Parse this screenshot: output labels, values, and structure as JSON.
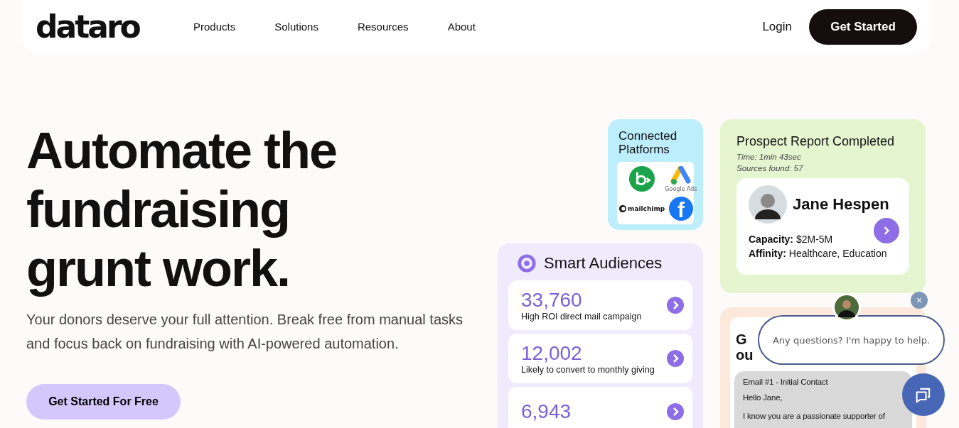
{
  "nav": {
    "logo": "dataro",
    "links": [
      "Products",
      "Solutions",
      "Resources",
      "About"
    ],
    "login": "Login",
    "cta": "Get Started"
  },
  "hero": {
    "title_lines": [
      "Automate the",
      "fundraising",
      "grunt work."
    ],
    "subtitle": "Your donors deserve your full attention. Break free from manual tasks and focus back on fundraising with AI-powered automation.",
    "cta": "Get Started For Free"
  },
  "connected": {
    "title": "Connected Platforms",
    "platforms": [
      {
        "kind": "green-circle"
      },
      {
        "kind": "ads",
        "label": "Google Ads"
      },
      {
        "kind": "wordmark",
        "label": "mailchimp"
      },
      {
        "kind": "blue-f",
        "label": "f"
      }
    ]
  },
  "prospect": {
    "title": "Prospect Report Completed",
    "time": "Time: 1min 43sec",
    "sources": "Sources found: 57",
    "name": "Jane Hespen",
    "fields": [
      {
        "label": "Capacity:",
        "value": "$2M-5M"
      },
      {
        "label": "Affinity:",
        "value": "Healthcare, Education"
      }
    ]
  },
  "audiences": {
    "title": "Smart Audiences",
    "rows": [
      {
        "count": "33,760",
        "label": "High ROI direct mail campaign"
      },
      {
        "count": "12,002",
        "label": "Likely to convert to monthly giving"
      },
      {
        "count": "6,943"
      }
    ]
  },
  "email_card": {
    "title_lines": [
      "G",
      "ou"
    ],
    "email_title": "Email #1 - Initial Contact",
    "greeting": "Hello Jane,",
    "body": "I know you are a passionate supporter of"
  },
  "chat": {
    "message": "Any questions? I'm happy to help.",
    "close": "×"
  }
}
